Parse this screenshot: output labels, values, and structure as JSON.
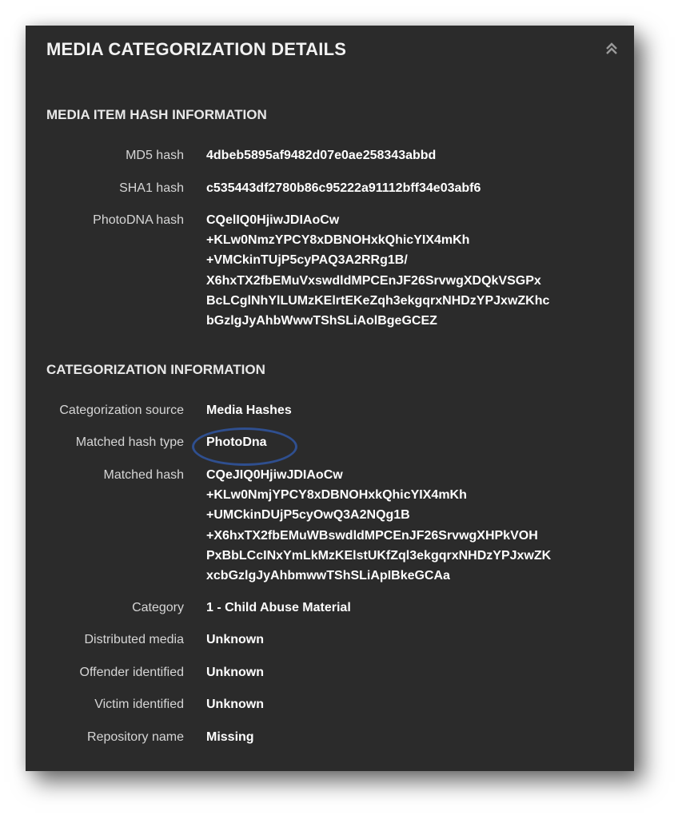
{
  "panel": {
    "title": "MEDIA CATEGORIZATION DETAILS",
    "collapse_icon": "double-chevron-up-icon"
  },
  "hash_info": {
    "title": "MEDIA ITEM HASH INFORMATION",
    "md5": {
      "label": "MD5 hash",
      "value": "4dbeb5895af9482d07e0ae258343abbd"
    },
    "sha1": {
      "label": "SHA1 hash",
      "value": "c535443df2780b86c95222a91112bff34e03abf6"
    },
    "photodna": {
      "label": "PhotoDNA hash",
      "lines": [
        "CQelIQ0HjiwJDIAoCw",
        "+KLw0NmzYPCY8xDBNOHxkQhicYIX4mKh",
        "+VMCkinTUjP5cyPAQ3A2RRg1B/",
        "X6hxTX2fbEMuVxswdldMPCEnJF26SrvwgXDQkVSGPx",
        "BcLCglNhYlLUMzKElrtEKeZqh3ekgqrxNHDzYPJxwZKhc",
        "bGzlgJyAhbWwwTShSLiAolBgeGCEZ"
      ]
    }
  },
  "categorization_info": {
    "title": "CATEGORIZATION INFORMATION",
    "source": {
      "label": "Categorization source",
      "value": "Media Hashes"
    },
    "matched_type": {
      "label": "Matched hash type",
      "value": "PhotoDna",
      "highlight_color": "#2f4f8f"
    },
    "matched_hash": {
      "label": "Matched hash",
      "lines": [
        "CQeJIQ0HjiwJDIAoCw",
        "+KLw0NmjYPCY8xDBNOHxkQhicYIX4mKh",
        "+UMCkinDUjP5cyOwQ3A2NQg1B",
        "+X6hxTX2fbEMuWBswdldMPCEnJF26SrvwgXHPkVOH",
        "PxBbLCcINxYmLkMzKElstUKfZql3ekgqrxNHDzYPJxwZK",
        "xcbGzlgJyAhbmwwTShSLiApIBkeGCAa"
      ]
    },
    "category": {
      "label": "Category",
      "value": "1 - Child Abuse Material"
    },
    "distributed_media": {
      "label": "Distributed media",
      "value": "Unknown"
    },
    "offender_identified": {
      "label": "Offender identified",
      "value": "Unknown"
    },
    "victim_identified": {
      "label": "Victim identified",
      "value": "Unknown"
    },
    "repository_name": {
      "label": "Repository name",
      "value": "Missing"
    }
  }
}
